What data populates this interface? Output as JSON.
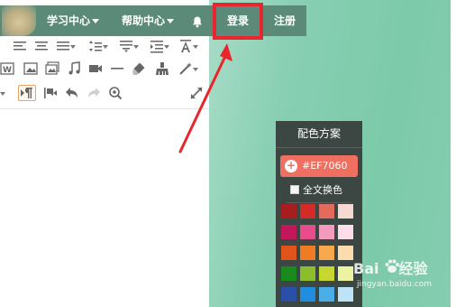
{
  "nav": {
    "items": [
      {
        "label": "学习中心"
      },
      {
        "label": "帮助中心"
      }
    ],
    "login_label": "登录",
    "register_label": "注册"
  },
  "toolbar": {
    "rows": [
      [
        "align-left-icon",
        "align-center-icon",
        "align-justify-icon",
        "line-height-icon",
        "paragraph-spacing-icon",
        "indent-icon",
        "font-size-icon"
      ],
      [
        "word-icon",
        "image-icon",
        "multi-image-icon",
        "music-icon",
        "video-icon",
        "horizontal-rule-icon",
        "eraser-icon",
        "format-painter-icon",
        "magic-wand-icon"
      ],
      [
        "rtl-icon",
        "ltr-icon",
        "undo-icon",
        "redo-icon",
        "find-icon",
        "fullscreen-icon"
      ]
    ]
  },
  "color_panel": {
    "title": "配色方案",
    "current_color": "#EF7060",
    "whole_text_label": "全文换色",
    "swatches": [
      [
        "#a81d1d",
        "#d42a28",
        "#e56a5e",
        "#f8d9d2"
      ],
      [
        "#c2185b",
        "#e84c8a",
        "#f29bbd",
        "#fbdce8"
      ],
      [
        "#e0531a",
        "#f07b22",
        "#f6a94e",
        "#fbdcae"
      ],
      [
        "#1a8a1f",
        "#8cbd2a",
        "#c6d72f",
        "#eef3a2"
      ],
      [
        "#2a4fa8",
        "#1f8de0",
        "#4aaee8",
        "#bfe3f6"
      ]
    ]
  },
  "watermark": {
    "brand": "Bai",
    "brand_suffix": "经验",
    "url": "jingyan.baidu.com"
  },
  "colors": {
    "nav_bg": "#5b8a78",
    "highlight": "#e8262b",
    "accent": "#ef7060",
    "panel_bg": "#3c4743"
  }
}
